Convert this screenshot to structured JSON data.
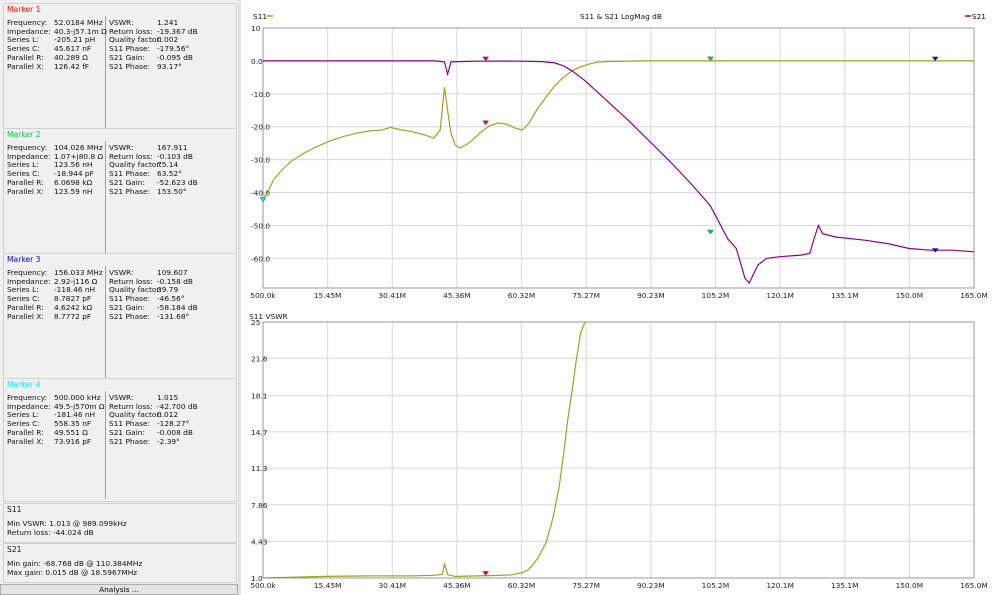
{
  "markers": [
    {
      "title": "Marker 1",
      "color": "#ff0000",
      "left": [
        [
          "Frequency:",
          "52.0184 MHz"
        ],
        [
          "Impedance:",
          "40.3-j57.1m Ω"
        ],
        [
          "Series L:",
          "-205.21 pH"
        ],
        [
          "Series C:",
          "45.617 nF"
        ],
        [
          "Parallel R:",
          "40.289 Ω"
        ],
        [
          "Parallel X:",
          "126.42 fF"
        ]
      ],
      "right": [
        [
          "VSWR:",
          "1.241"
        ],
        [
          "Return loss:",
          "-19.367 dB"
        ],
        [
          "Quality factor:",
          "0.002"
        ],
        [
          "S11 Phase:",
          "-179.56°"
        ],
        [
          "S21 Gain:",
          "-0.095 dB"
        ],
        [
          "S21 Phase:",
          "93.17°"
        ]
      ]
    },
    {
      "title": "Marker 2",
      "color": "#00cc44",
      "left": [
        [
          "Frequency:",
          "104.026 MHz"
        ],
        [
          "Impedance:",
          "1.07+j80.8 Ω"
        ],
        [
          "Series L:",
          "123.56 nH"
        ],
        [
          "Series C:",
          "-18.944 pF"
        ],
        [
          "Parallel R:",
          "6.0698 kΩ"
        ],
        [
          "Parallel X:",
          "123.59 nH"
        ]
      ],
      "right": [
        [
          "VSWR:",
          "167.911"
        ],
        [
          "Return loss:",
          "-0.103 dB"
        ],
        [
          "Quality factor:",
          "75.14"
        ],
        [
          "S11 Phase:",
          "63.52°"
        ],
        [
          "S21 Gain:",
          "-52.623 dB"
        ],
        [
          "S21 Phase:",
          "153.50°"
        ]
      ]
    },
    {
      "title": "Marker 3",
      "color": "#0000ff",
      "left": [
        [
          "Frequency:",
          "156.033 MHz"
        ],
        [
          "Impedance:",
          "2.92-j116 Ω"
        ],
        [
          "Series L:",
          "-118.46 nH"
        ],
        [
          "Series C:",
          "8.7827 pF"
        ],
        [
          "Parallel R:",
          "4.6242 kΩ"
        ],
        [
          "Parallel X:",
          "8.7772 pF"
        ]
      ],
      "right": [
        [
          "VSWR:",
          "109.607"
        ],
        [
          "Return loss:",
          "-0.158 dB"
        ],
        [
          "Quality factor:",
          "39.79"
        ],
        [
          "S11 Phase:",
          "-46.56°"
        ],
        [
          "S21 Gain:",
          "-58.184 dB"
        ],
        [
          "S21 Phase:",
          "-131.68°"
        ]
      ]
    },
    {
      "title": "Marker 4",
      "color": "#00e5ff",
      "left": [
        [
          "Frequency:",
          "500.000 kHz"
        ],
        [
          "Impedance:",
          "49.5-j570m Ω"
        ],
        [
          "Series L:",
          "-181.46 nH"
        ],
        [
          "Series C:",
          "558.35 nF"
        ],
        [
          "Parallel R:",
          "49.551 Ω"
        ],
        [
          "Parallel X:",
          "73.916 pF"
        ]
      ],
      "right": [
        [
          "VSWR:",
          "1.015"
        ],
        [
          "Return loss:",
          "-42.700 dB"
        ],
        [
          "Quality factor:",
          "0.012"
        ],
        [
          "S11 Phase:",
          "-128.27°"
        ],
        [
          "S21 Gain:",
          "-0.008 dB"
        ],
        [
          "S21 Phase:",
          "-2.39°"
        ]
      ]
    }
  ],
  "s11_summary": {
    "title": "S11",
    "min_vswr": "Min VSWR:   1.013 @ 989.099kHz",
    "return_loss": "Return loss:  -44.024 dB"
  },
  "s21_summary": {
    "title": "S21",
    "min_gain": "Min gain:   -68.768 dB @ 110.384MHz",
    "max_gain": "Max gain:  0.015 dB @ 18.5967MHz"
  },
  "analysis_button": "Analysis ...",
  "colors": {
    "s11": "#a0a020",
    "s21": "#8b008b",
    "grid": "#d8d8d8",
    "marker1": "#ff0000",
    "marker2": "#00cc44",
    "marker3": "#0000ff",
    "marker4": "#00e5ff"
  },
  "chart_data": [
    {
      "type": "line",
      "title": "S11 & S21 LogMag dB",
      "legend_left": "S11",
      "legend_right": "S21",
      "x_tick_labels": [
        "500.0k",
        "15.45M",
        "30.41M",
        "45.36M",
        "60.32M",
        "75.27M",
        "90.23M",
        "105.2M",
        "120.1M",
        "135.1M",
        "150.0M",
        "165.0M"
      ],
      "y_tick_labels": [
        "10",
        "0.0",
        "-10.0",
        "-20.0",
        "-30.0",
        "-40.0",
        "-50.0",
        "-60.0"
      ],
      "xlim": [
        0.5,
        165.0
      ],
      "ylim": [
        -69,
        10
      ],
      "xlabel": "",
      "ylabel": "",
      "series": [
        {
          "name": "S11",
          "x": [
            0.5,
            1.5,
            3,
            5,
            7,
            10,
            13,
            16,
            19,
            22,
            25,
            28,
            30,
            32,
            35,
            38,
            40,
            41.5,
            42.5,
            43.2,
            44,
            45,
            46,
            47.5,
            49,
            51,
            53,
            55,
            57,
            59,
            60.5,
            62,
            64,
            66,
            68,
            70,
            72,
            74,
            76,
            78,
            80,
            85,
            90,
            100,
            110,
            120,
            130,
            140,
            150,
            160,
            165
          ],
          "y": [
            -43,
            -40,
            -36,
            -33,
            -30.5,
            -28,
            -26,
            -24.3,
            -23,
            -22,
            -21.3,
            -21,
            -20.2,
            -20.8,
            -21.5,
            -22.5,
            -23.5,
            -21,
            -8,
            -15,
            -22,
            -25.5,
            -26.5,
            -25.5,
            -24,
            -21.5,
            -19.7,
            -18.8,
            -19.3,
            -20.5,
            -21,
            -19,
            -14.5,
            -11,
            -7.5,
            -5,
            -3,
            -1.8,
            -0.9,
            -0.4,
            -0.2,
            -0.05,
            0,
            0,
            0,
            0,
            0,
            0,
            0,
            0,
            0
          ]
        },
        {
          "name": "S21",
          "x": [
            0.5,
            10,
            20,
            30,
            40,
            42.5,
            43.2,
            44,
            50,
            55,
            60,
            65,
            68,
            70,
            72,
            75,
            80,
            85,
            90,
            95,
            100,
            104,
            106,
            108,
            110,
            112,
            113,
            115,
            117,
            120,
            125,
            127,
            128,
            129,
            130,
            133,
            140,
            145,
            150,
            155,
            160,
            165
          ],
          "y": [
            0,
            0,
            0,
            0,
            0,
            -0.3,
            -4,
            -0.3,
            -0.1,
            -0.05,
            -0.1,
            -0.2,
            -0.6,
            -1.5,
            -3,
            -6,
            -12,
            -18,
            -24.5,
            -31,
            -38,
            -44,
            -49,
            -54,
            -57,
            -66,
            -67.5,
            -62,
            -60,
            -59.5,
            -59,
            -58.5,
            -54,
            -50,
            -52.5,
            -53.5,
            -54.5,
            -55.5,
            -57,
            -57.5,
            -57.5,
            -58
          ]
        }
      ]
    },
    {
      "type": "line",
      "title": "S11 VSWR",
      "x_tick_labels": [
        "500.0k",
        "15.45M",
        "30.41M",
        "45.36M",
        "60.32M",
        "75.27M",
        "90.23M",
        "105.2M",
        "120.1M",
        "135.1M",
        "150.0M",
        "165.0M"
      ],
      "y_tick_labels": [
        "25",
        "21.6",
        "18.1",
        "14.7",
        "11.3",
        "7.86",
        "4.43",
        "1.0"
      ],
      "xlim": [
        0.5,
        165.0
      ],
      "ylim": [
        1.0,
        25
      ],
      "xlabel": "",
      "ylabel": "",
      "series": [
        {
          "name": "S11",
          "x": [
            0.5,
            5,
            15,
            25,
            35,
            40,
            42,
            42.5,
            43.3,
            45,
            50,
            55,
            58,
            60.5,
            62,
            64,
            66,
            67.5,
            69,
            70,
            71,
            72,
            73,
            74,
            75
          ],
          "y": [
            1.02,
            1.05,
            1.15,
            1.2,
            1.2,
            1.25,
            1.35,
            2.3,
            1.3,
            1.15,
            1.2,
            1.24,
            1.3,
            1.5,
            1.8,
            2.8,
            4.3,
            6.5,
            9.5,
            12.5,
            15.8,
            18.5,
            21.5,
            24,
            25
          ]
        }
      ]
    }
  ]
}
